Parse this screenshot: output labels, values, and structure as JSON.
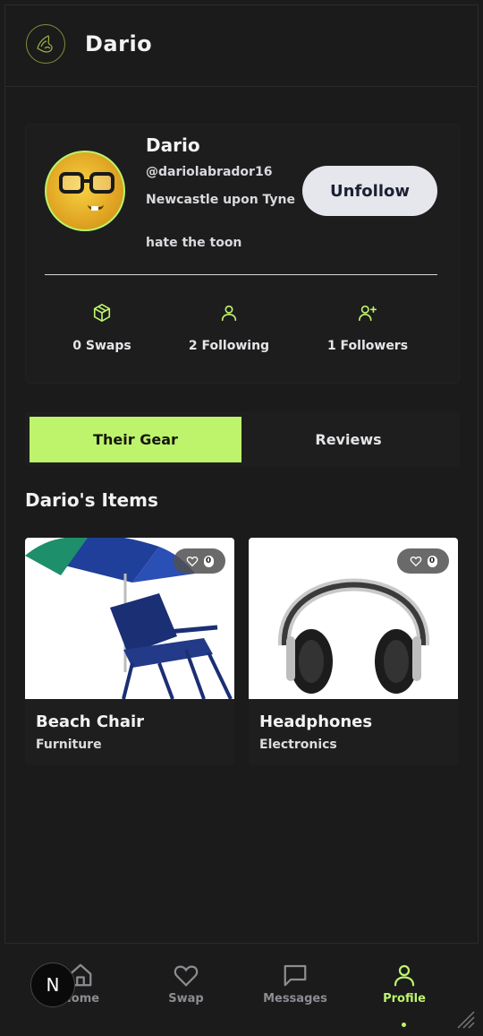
{
  "header": {
    "brand": "Dario",
    "logo_icon": "hand-logo-icon"
  },
  "profile": {
    "name": "Dario",
    "handle": "@dariolabrador16",
    "location": "Newcastle upon Tyne",
    "bio": "hate the toon",
    "unfollow_label": "Unfollow",
    "stats": [
      {
        "icon": "box-icon",
        "label": "0 Swaps"
      },
      {
        "icon": "user-icon",
        "label": "2 Following"
      },
      {
        "icon": "user-plus-icon",
        "label": "1 Followers"
      }
    ]
  },
  "tabs": [
    {
      "label": "Their Gear",
      "active": true
    },
    {
      "label": "Reviews",
      "active": false
    }
  ],
  "items_section": {
    "title": "Dario's Items"
  },
  "items": [
    {
      "title": "Beach Chair",
      "category": "Furniture",
      "likes": "0"
    },
    {
      "title": "Headphones",
      "category": "Electronics",
      "likes": "0"
    }
  ],
  "nav": [
    {
      "label": "Home",
      "icon": "home-icon"
    },
    {
      "label": "Swap",
      "icon": "heart-icon"
    },
    {
      "label": "Messages",
      "icon": "message-icon"
    },
    {
      "label": "Profile",
      "icon": "user-icon",
      "active": true
    }
  ],
  "overlay_badge": "N",
  "colors": {
    "accent": "#bdf46c",
    "background": "#1b1b1b",
    "button": "#e6e7ec"
  }
}
